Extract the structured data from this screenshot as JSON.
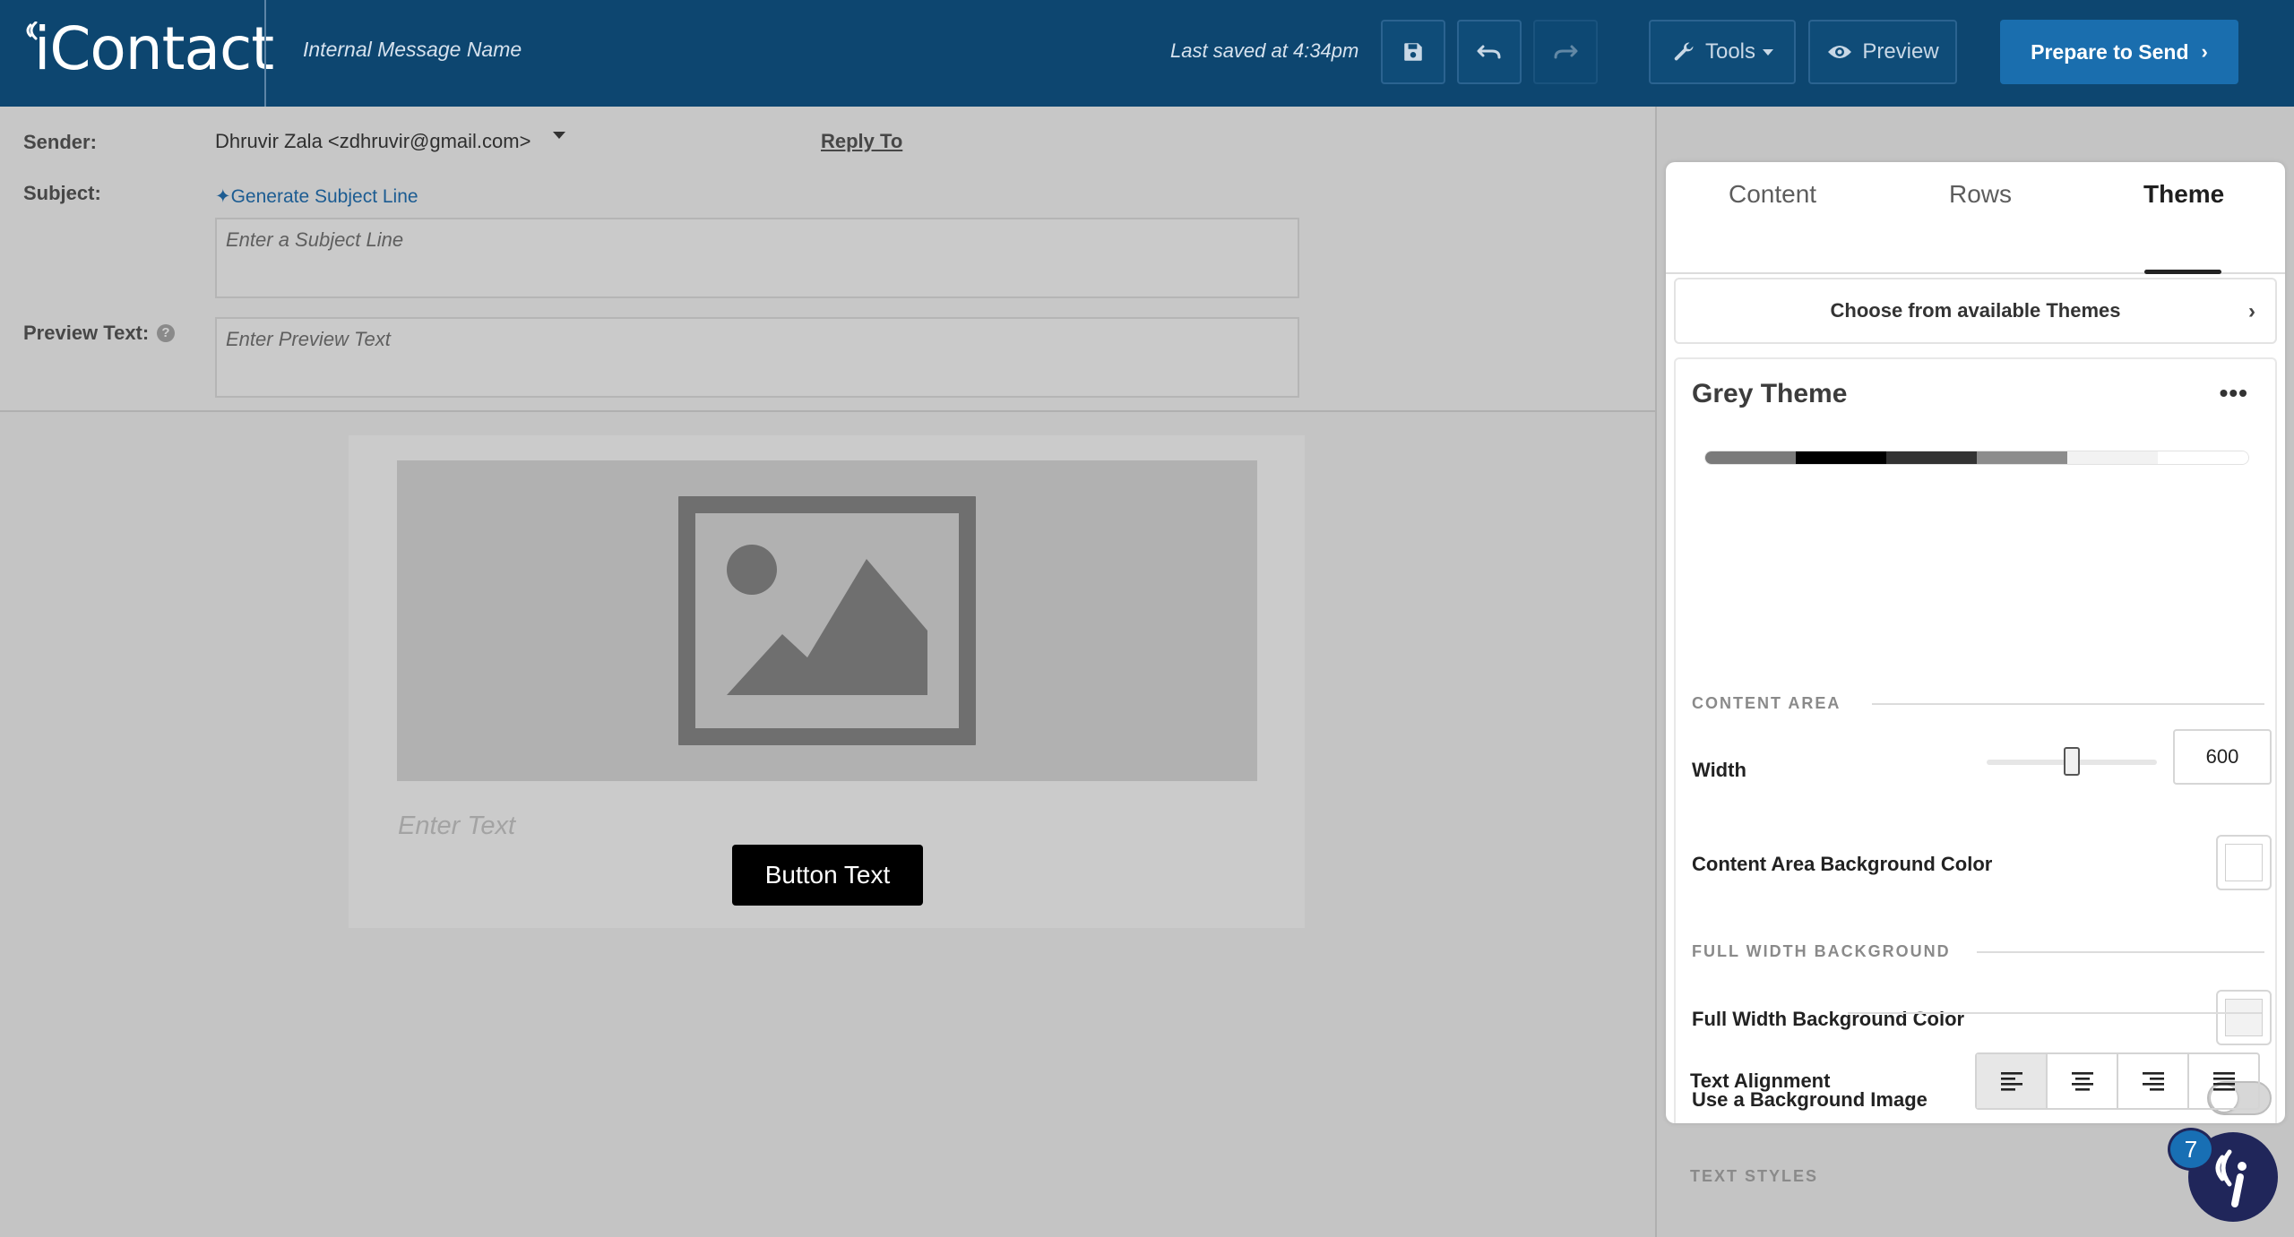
{
  "header": {
    "logo_text": "iContact",
    "message_name_placeholder": "Internal Message Name",
    "last_saved": "Last saved at 4:34pm",
    "tools_label": "Tools",
    "preview_label": "Preview",
    "prepare_label": "Prepare to Send",
    "prepare_chevron": "›"
  },
  "form": {
    "sender_label": "Sender:",
    "sender_value": "Dhruvir Zala <zdhruvir@gmail.com>",
    "reply_to": "Reply To",
    "subject_label": "Subject:",
    "generate_subject": "✦Generate Subject Line",
    "subject_placeholder": "Enter a Subject Line",
    "preview_label": "Preview Text:",
    "preview_placeholder": "Enter Preview Text",
    "help_glyph": "?"
  },
  "canvas": {
    "enter_text": "Enter Text",
    "button_text": "Button Text"
  },
  "panel": {
    "tabs": [
      {
        "label": "Content",
        "active": false
      },
      {
        "label": "Rows",
        "active": false
      },
      {
        "label": "Theme",
        "active": true
      }
    ],
    "choose_themes": "Choose from available Themes",
    "choose_chevron": "›",
    "theme_name": "Grey Theme",
    "theme_menu": "•••",
    "theme_swatches": [
      "#7a7a7a",
      "#000000",
      "#333333",
      "#8c8c8c",
      "#f2f2f2",
      "#ffffff"
    ],
    "content_area_heading": "CONTENT AREA",
    "width_label": "Width",
    "width_value": "600",
    "content_bg_label": "Content Area Background Color",
    "content_bg_color": "#ffffff",
    "full_width_heading": "FULL WIDTH BACKGROUND",
    "full_width_bg_label": "Full Width Background Color",
    "full_width_bg_color": "#f2f2f2",
    "bg_image_label": "Use a Background Image",
    "bg_image_enabled": false,
    "text_styles_heading": "TEXT STYLES",
    "text_alignment_label": "Text Alignment",
    "text_alignment_selected": "left"
  },
  "chat": {
    "badge_count": "7"
  },
  "colors": {
    "header_bg": "#0d4670",
    "primary_button": "#1a6eae",
    "chat_bg": "#20265a",
    "badge_bg": "#186fb4"
  }
}
